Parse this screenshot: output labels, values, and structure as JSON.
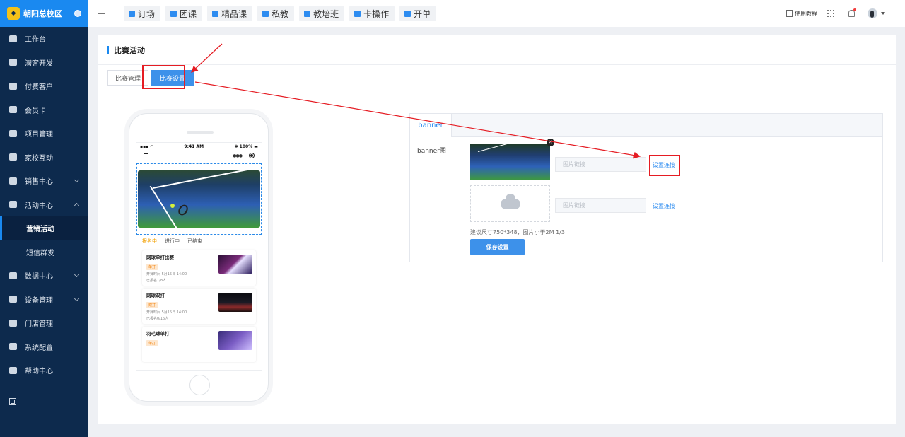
{
  "brand": {
    "name": "朝阳总校区"
  },
  "sidebar": {
    "items": [
      {
        "label": "工作台"
      },
      {
        "label": "潜客开发"
      },
      {
        "label": "付费客户"
      },
      {
        "label": "会员卡"
      },
      {
        "label": "项目管理"
      },
      {
        "label": "家校互动"
      },
      {
        "label": "销售中心"
      },
      {
        "label": "活动中心"
      },
      {
        "label": "营销活动"
      },
      {
        "label": "短信群发"
      },
      {
        "label": "数据中心"
      },
      {
        "label": "设备管理"
      },
      {
        "label": "门店管理"
      },
      {
        "label": "系统配置"
      },
      {
        "label": "帮助中心"
      }
    ]
  },
  "topbar": {
    "tabs": [
      "订场",
      "团课",
      "精品课",
      "私教",
      "教培班",
      "卡操作",
      "开单"
    ],
    "guide": "使用教程"
  },
  "page": {
    "title": "比赛活动",
    "subtabs": [
      "比赛管理",
      "比赛设置"
    ]
  },
  "phone": {
    "status_time": "9:41 AM",
    "status_battery": "100%",
    "list_tabs": [
      "报名中",
      "进行中",
      "已结束"
    ],
    "events": [
      {
        "name": "网球单打比赛",
        "tag": "单打",
        "time": "开赛时间 5月15日 14:00",
        "count": "已报名1/8人"
      },
      {
        "name": "网球双打",
        "tag": "双打",
        "time": "开赛时间 5月15日 14:00",
        "count": "已报名0/16人"
      },
      {
        "name": "羽毛球单打",
        "tag": "单打",
        "time": "",
        "count": ""
      }
    ]
  },
  "form": {
    "tab": "banner",
    "label": "banner图",
    "link_placeholder": "图片链接",
    "set_link": "设置连接",
    "hint": "建议尺寸750*348，图片小于2M 1/3",
    "save": "保存设置"
  },
  "colors": {
    "sidebar_bg": "#0d2a4d",
    "brand_blue": "#1a89f0",
    "accent": "#2d8cf0",
    "highlight": "#e51c23"
  }
}
